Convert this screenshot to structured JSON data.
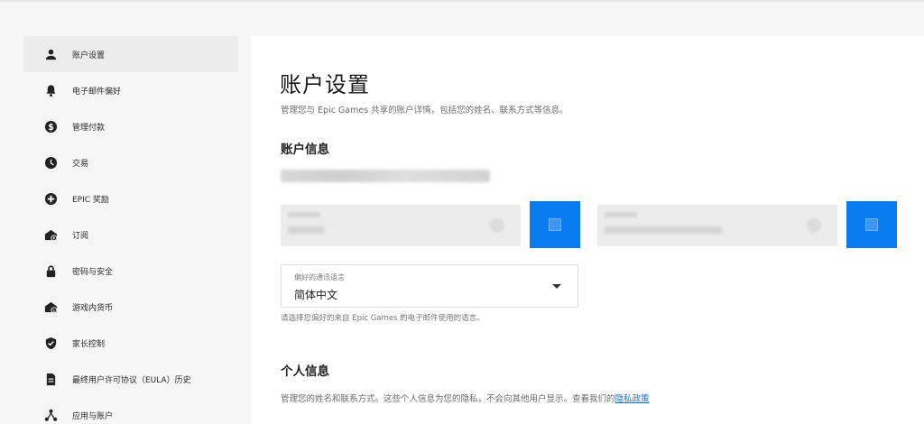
{
  "sidebar": {
    "items": [
      {
        "label": "账户设置",
        "icon": "person-icon",
        "active": true
      },
      {
        "label": "电子邮件偏好",
        "icon": "bell-icon"
      },
      {
        "label": "管理付款",
        "icon": "dollar-icon"
      },
      {
        "label": "交易",
        "icon": "clock-icon"
      },
      {
        "label": "EPIC 奖励",
        "icon": "plus-circle-icon"
      },
      {
        "label": "订阅",
        "icon": "subscription-icon"
      },
      {
        "label": "密码与安全",
        "icon": "lock-icon"
      },
      {
        "label": "游戏内货币",
        "icon": "currency-icon"
      },
      {
        "label": "家长控制",
        "icon": "shield-icon"
      },
      {
        "label": "最终用户许可协议（EULA）历史",
        "icon": "document-icon"
      },
      {
        "label": "应用与账户",
        "icon": "apps-icon"
      }
    ]
  },
  "main": {
    "title": "账户设置",
    "subtitle": "管理您与 Epic Games 共享的账户详情，包括您的姓名、联系方式等信息。",
    "account_info_title": "账户信息",
    "language": {
      "label": "偏好的通讯语言",
      "value": "简体中文",
      "help": "请选择您偏好的来自 Epic Games 的电子邮件使用的语言。"
    },
    "personal_info_title": "个人信息",
    "personal_info_sub": "管理您的姓名和联系方式。这些个人信息为您的隐私，不会向其他用户显示。查看我们的",
    "privacy_link": "隐私政策"
  },
  "colors": {
    "accent": "#0a7bf0",
    "link": "#1a73d6"
  }
}
